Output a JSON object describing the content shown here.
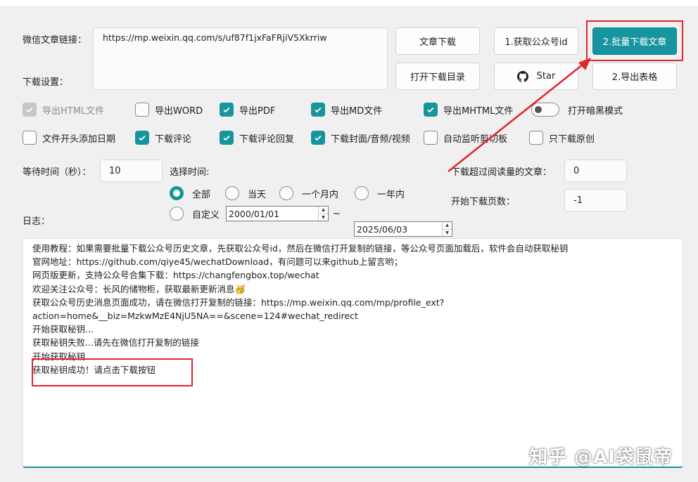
{
  "labels": {
    "url_label": "微信文章链接：",
    "download_settings": "下载设置：",
    "wait_time": "等待时间（秒）：",
    "select_time": "选择时间:",
    "skip_read": "下载超过阅读量的文章：",
    "start_page": "开始下载页数：",
    "log": "日志："
  },
  "url_input": {
    "value": "https://mp.weixin.qq.com/s/uf87f1jxFaFRjiV5Xkrriw"
  },
  "buttons": {
    "download_article": "文章下载",
    "get_account_id": "1.获取公众号id",
    "batch_download": "2.批量下载文章",
    "open_download_dir": "打开下载目录",
    "star": "Star",
    "export_table": "2.导出表格"
  },
  "checkboxes_row1": [
    {
      "label": "导出HTML文件",
      "state": "disabled-checked"
    },
    {
      "label": "导出WORD",
      "state": "unchecked"
    },
    {
      "label": "导出PDF",
      "state": "checked"
    },
    {
      "label": "导出MD文件",
      "state": "checked"
    },
    {
      "label": "导出MHTML文件",
      "state": "checked"
    }
  ],
  "dark_mode": {
    "label": "打开暗黑模式",
    "on": false
  },
  "checkboxes_row2": [
    {
      "label": "文件开头添加日期",
      "state": "unchecked"
    },
    {
      "label": "下载评论",
      "state": "checked"
    },
    {
      "label": "下载评论回复",
      "state": "checked"
    },
    {
      "label": "下载封面/音频/视频",
      "state": "checked"
    },
    {
      "label": "自动监听剪切板",
      "state": "unchecked"
    },
    {
      "label": "只下载原创",
      "state": "unchecked"
    }
  ],
  "wait_time_value": "10",
  "read_threshold_value": "0",
  "start_page_value": "-1",
  "time_options": {
    "all": "全部",
    "today": "当天",
    "month": "一个月内",
    "year": "一年内",
    "custom": "自定义",
    "selected": "all"
  },
  "date_from": "2000/01/01",
  "date_sep": "~",
  "date_to": "2025/06/03",
  "log_lines": [
    "使用教程：如果需要批量下载公众号历史文章，先获取公众号id，然后在微信打开复制的链接，等公众号页面加载后，软件会自动获取秘钥",
    "官网地址：https://github.com/qiye45/wechatDownload，有问题可以来github上留言哟；",
    "网页版更新，支持公众号合集下载：https://changfengbox.top/wechat",
    "欢迎关注公众号：长风的储物柜，获取最新更新消息🥳",
    "获取公众号历史消息页面成功，请在微信打开复制的链接：https://mp.weixin.qq.com/mp/profile_ext?",
    "action=home&__biz=MzkwMzE4NjU5NA==&scene=124#wechat_redirect",
    "开始获取秘钥...",
    "获取秘钥失败...请先在微信打开复制的链接",
    "开始获取秘钥...",
    "获取秘钥成功！请点击下载按钮"
  ],
  "watermark": "知乎 @AI袋鼠帝",
  "colors": {
    "accent": "#17959e",
    "annotation_red": "#e0262d"
  },
  "icons": {
    "github": "github-icon",
    "check": "check-icon",
    "spin_up": "spin-up-icon",
    "spin_down": "spin-down-icon"
  }
}
